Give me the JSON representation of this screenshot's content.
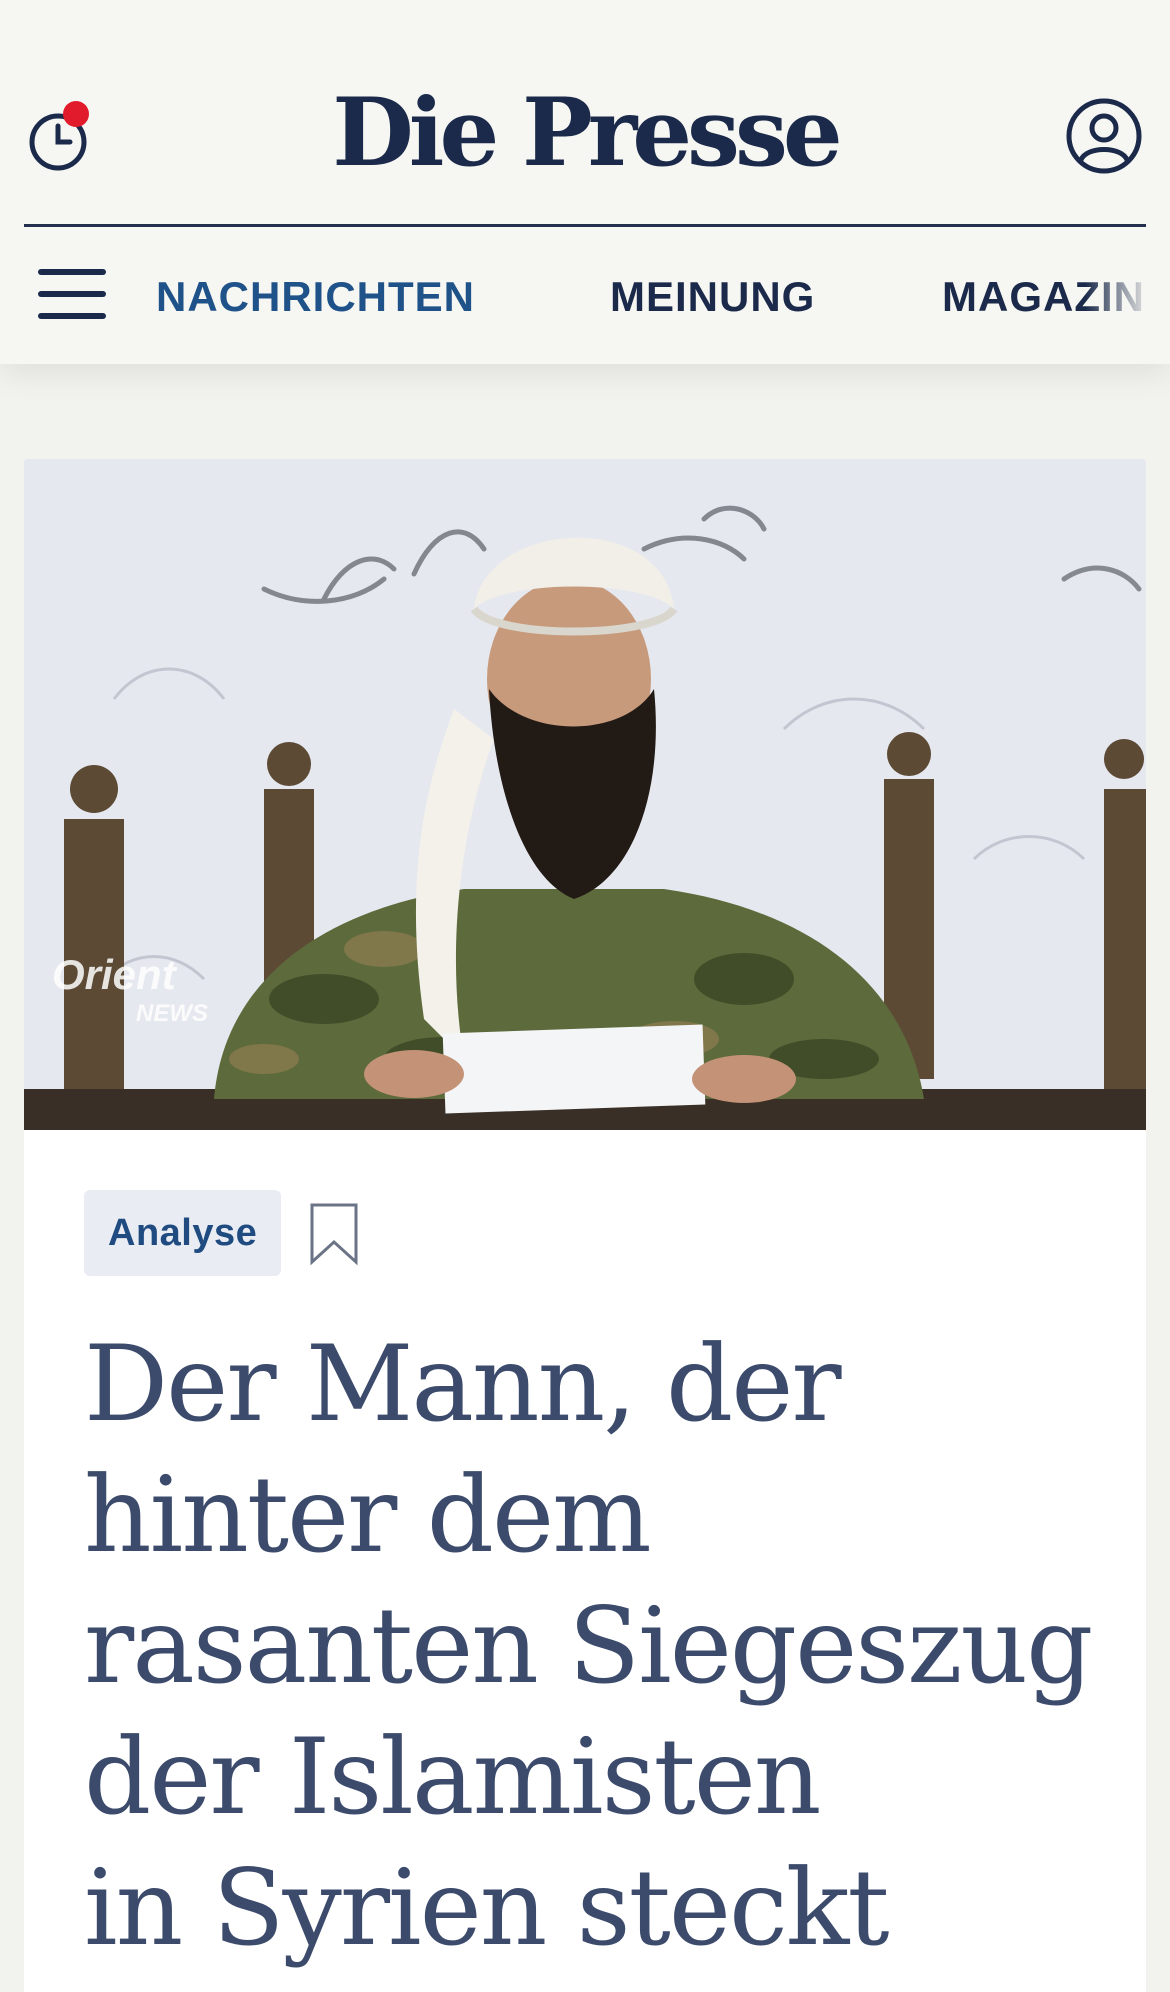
{
  "header": {
    "logo": "Die Presse",
    "history_icon": "history-clock-icon",
    "account_icon": "account-icon",
    "menu_icon": "hamburger-menu-icon",
    "nav_items": [
      {
        "label": "NACHRICHTEN",
        "active": true
      },
      {
        "label": "MEINUNG",
        "active": false
      },
      {
        "label": "MAGAZIN",
        "active": false
      }
    ]
  },
  "article": {
    "image_watermark_line1": "Orient",
    "image_watermark_line2": "NEWS",
    "tag": "Analyse",
    "bookmark_icon": "bookmark-icon",
    "headline_lines": [
      "Der Mann, der",
      "hinter dem",
      "rasanten Siegeszug",
      "der Islamisten",
      "in Syrien steckt"
    ]
  },
  "colors": {
    "brand_navy": "#1b2a4a",
    "nav_active": "#1f5289",
    "notification_dot": "#e21b2c",
    "headline": "#3c4b6c",
    "tag_bg": "#e9edf3"
  }
}
